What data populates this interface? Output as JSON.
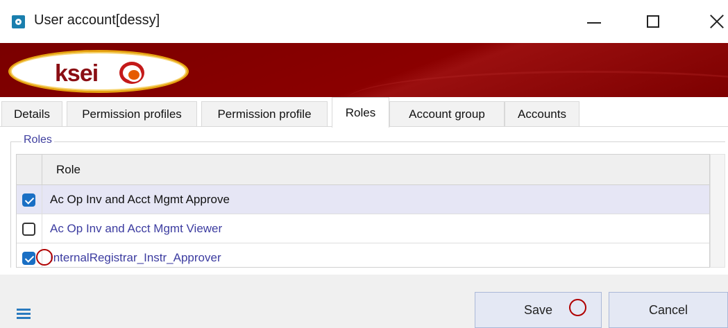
{
  "window": {
    "title": "User account[dessy]",
    "app_icon": "app-globe-icon",
    "controls": [
      "minimize-icon",
      "maximize-icon",
      "close-icon"
    ]
  },
  "banner": {
    "logo_text": "ksei",
    "colors": {
      "background": "#8b0000",
      "logo_ring": "#e6a412",
      "logo_text": "#8a0e14"
    }
  },
  "tabs": [
    {
      "label": "Details",
      "active": false
    },
    {
      "label": "Permission profiles",
      "active": false
    },
    {
      "label": "Permission profile",
      "active": false
    },
    {
      "label": "Roles",
      "active": true
    },
    {
      "label": "Account group",
      "active": false
    },
    {
      "label": "Accounts",
      "active": false
    }
  ],
  "roles_group": {
    "title": "Roles",
    "column_header": "Role",
    "rows": [
      {
        "label": "Ac Op Inv and Acct Mgmt Approve",
        "checked": true,
        "selected": true
      },
      {
        "label": "Ac Op Inv and Acct Mgmt Viewer",
        "checked": false,
        "selected": false
      },
      {
        "label": "InternalRegistrar_Instr_Approver",
        "checked": true,
        "selected": false
      }
    ]
  },
  "footer": {
    "menu_icon": "hamburger-menu-icon",
    "save_label": "Save",
    "cancel_label": "Cancel"
  },
  "colors": {
    "accent": "#1a6fc4",
    "role_text": "#3c3ca0",
    "annotation": "#b00000"
  }
}
